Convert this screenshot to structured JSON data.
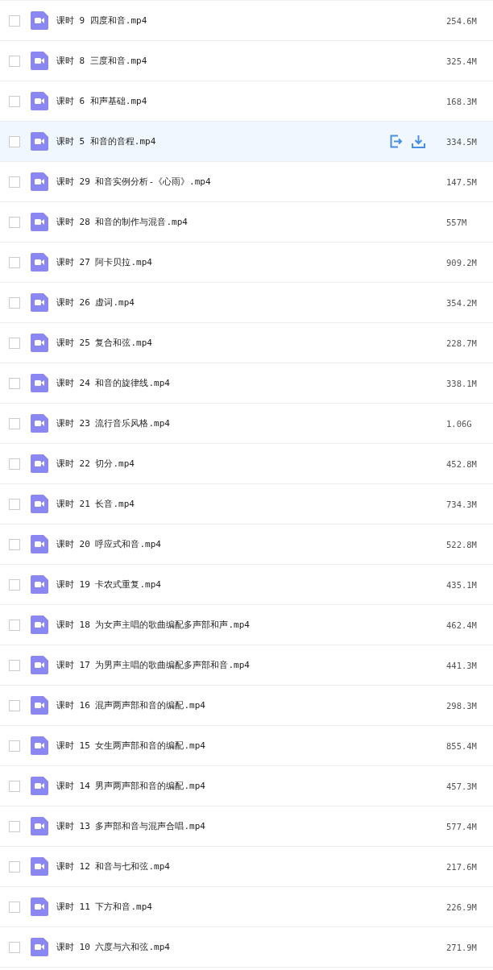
{
  "files": [
    {
      "name": "课时 9 四度和音.mp4",
      "size": "254.6M",
      "checked": false,
      "hovered": false
    },
    {
      "name": "课时 8 三度和音.mp4",
      "size": "325.4M",
      "checked": false,
      "hovered": false
    },
    {
      "name": "课时 6 和声基础.mp4",
      "size": "168.3M",
      "checked": false,
      "hovered": false
    },
    {
      "name": "课时 5 和音的音程.mp4",
      "size": "334.5M",
      "checked": false,
      "hovered": true
    },
    {
      "name": "课时 29 和音实例分析-《心雨》.mp4",
      "size": "147.5M",
      "checked": false,
      "hovered": false
    },
    {
      "name": "课时 28 和音的制作与混音.mp4",
      "size": "557M",
      "checked": false,
      "hovered": false
    },
    {
      "name": "课时 27 阿卡贝拉.mp4",
      "size": "909.2M",
      "checked": false,
      "hovered": false
    },
    {
      "name": "课时 26 虚词.mp4",
      "size": "354.2M",
      "checked": false,
      "hovered": false
    },
    {
      "name": "课时 25 复合和弦.mp4",
      "size": "228.7M",
      "checked": false,
      "hovered": false
    },
    {
      "name": "课时 24 和音的旋律线.mp4",
      "size": "338.1M",
      "checked": false,
      "hovered": false
    },
    {
      "name": "课时 23 流行音乐风格.mp4",
      "size": "1.06G",
      "checked": false,
      "hovered": false
    },
    {
      "name": "课时 22 切分.mp4",
      "size": "452.8M",
      "checked": false,
      "hovered": false
    },
    {
      "name": "课时 21 长音.mp4",
      "size": "734.3M",
      "checked": false,
      "hovered": false
    },
    {
      "name": "课时 20 呼应式和音.mp4",
      "size": "522.8M",
      "checked": false,
      "hovered": false
    },
    {
      "name": "课时 19 卡农式重复.mp4",
      "size": "435.1M",
      "checked": false,
      "hovered": false
    },
    {
      "name": "课时 18 为女声主唱的歌曲编配多声部和声.mp4",
      "size": "462.4M",
      "checked": false,
      "hovered": false
    },
    {
      "name": "课时 17 为男声主唱的歌曲编配多声部和音.mp4",
      "size": "441.3M",
      "checked": false,
      "hovered": false
    },
    {
      "name": "课时 16 混声两声部和音的编配.mp4",
      "size": "298.3M",
      "checked": false,
      "hovered": false
    },
    {
      "name": "课时 15 女生两声部和音的编配.mp4",
      "size": "855.4M",
      "checked": false,
      "hovered": false
    },
    {
      "name": "课时 14 男声两声部和音的编配.mp4",
      "size": "457.3M",
      "checked": false,
      "hovered": false
    },
    {
      "name": "课时 13 多声部和音与混声合唱.mp4",
      "size": "577.4M",
      "checked": false,
      "hovered": false
    },
    {
      "name": "课时 12 和音与七和弦.mp4",
      "size": "217.6M",
      "checked": false,
      "hovered": false
    },
    {
      "name": "课时 11 下方和音.mp4",
      "size": "226.9M",
      "checked": false,
      "hovered": false
    },
    {
      "name": "课时 10 六度与六和弦.mp4",
      "size": "271.9M",
      "checked": false,
      "hovered": false
    }
  ]
}
